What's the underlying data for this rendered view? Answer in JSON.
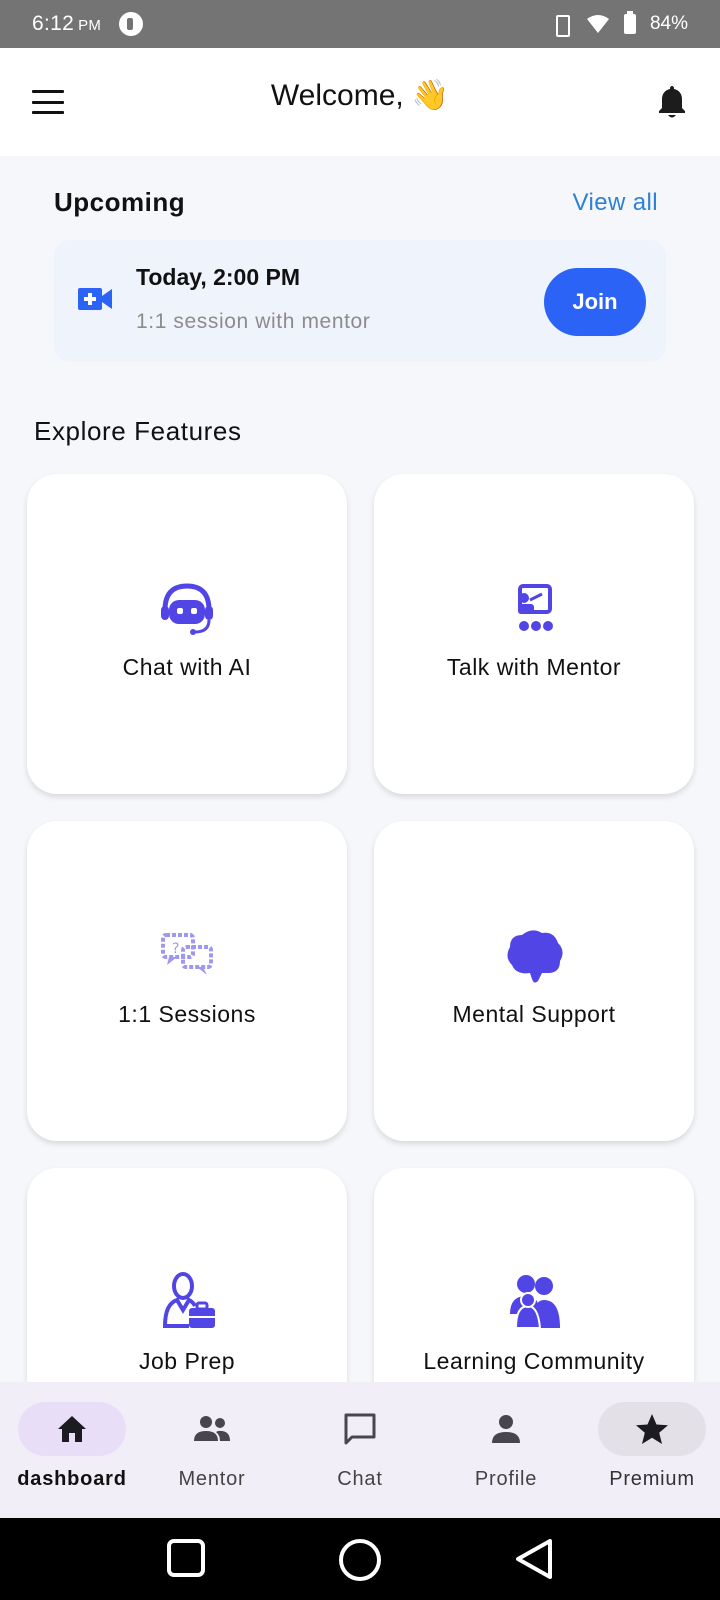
{
  "status_bar": {
    "time": "6:12",
    "ampm": "PM",
    "battery": "84%"
  },
  "header": {
    "welcome": "Welcome,",
    "wave_emoji": "👋",
    "menu_icon": "hamburger-menu-icon",
    "bell_icon": "notification-bell-icon"
  },
  "upcoming": {
    "title": "Upcoming",
    "view_all": "View all",
    "card": {
      "time": "Today, 2:00 PM",
      "description": "1:1 session with mentor",
      "join_label": "Join",
      "icon": "video-camera-icon"
    }
  },
  "explore": {
    "title": "Explore Features",
    "features": [
      {
        "label": "Chat with AI",
        "icon": "ai-chatbot-icon"
      },
      {
        "label": "Talk with Mentor",
        "icon": "mentor-presentation-icon"
      },
      {
        "label": "1:1 Sessions",
        "icon": "chat-bubbles-icon"
      },
      {
        "label": "Mental Support",
        "icon": "brain-icon"
      },
      {
        "label": "Job Prep",
        "icon": "job-briefcase-icon"
      },
      {
        "label": "Learning Community",
        "icon": "community-group-icon"
      }
    ]
  },
  "bottom_nav": {
    "items": [
      {
        "label": "dashboard",
        "icon": "home-icon",
        "active": true
      },
      {
        "label": "Mentor",
        "icon": "people-icon",
        "active": false
      },
      {
        "label": "Chat",
        "icon": "chat-icon",
        "active": false
      },
      {
        "label": "Profile",
        "icon": "person-icon",
        "active": false
      },
      {
        "label": "Premium",
        "icon": "star-icon",
        "active": false
      }
    ]
  },
  "colors": {
    "accent": "#2a63f5",
    "icon_purple": "#5145e6",
    "link_blue": "#2f80d8",
    "nav_active": "#e8def8"
  }
}
